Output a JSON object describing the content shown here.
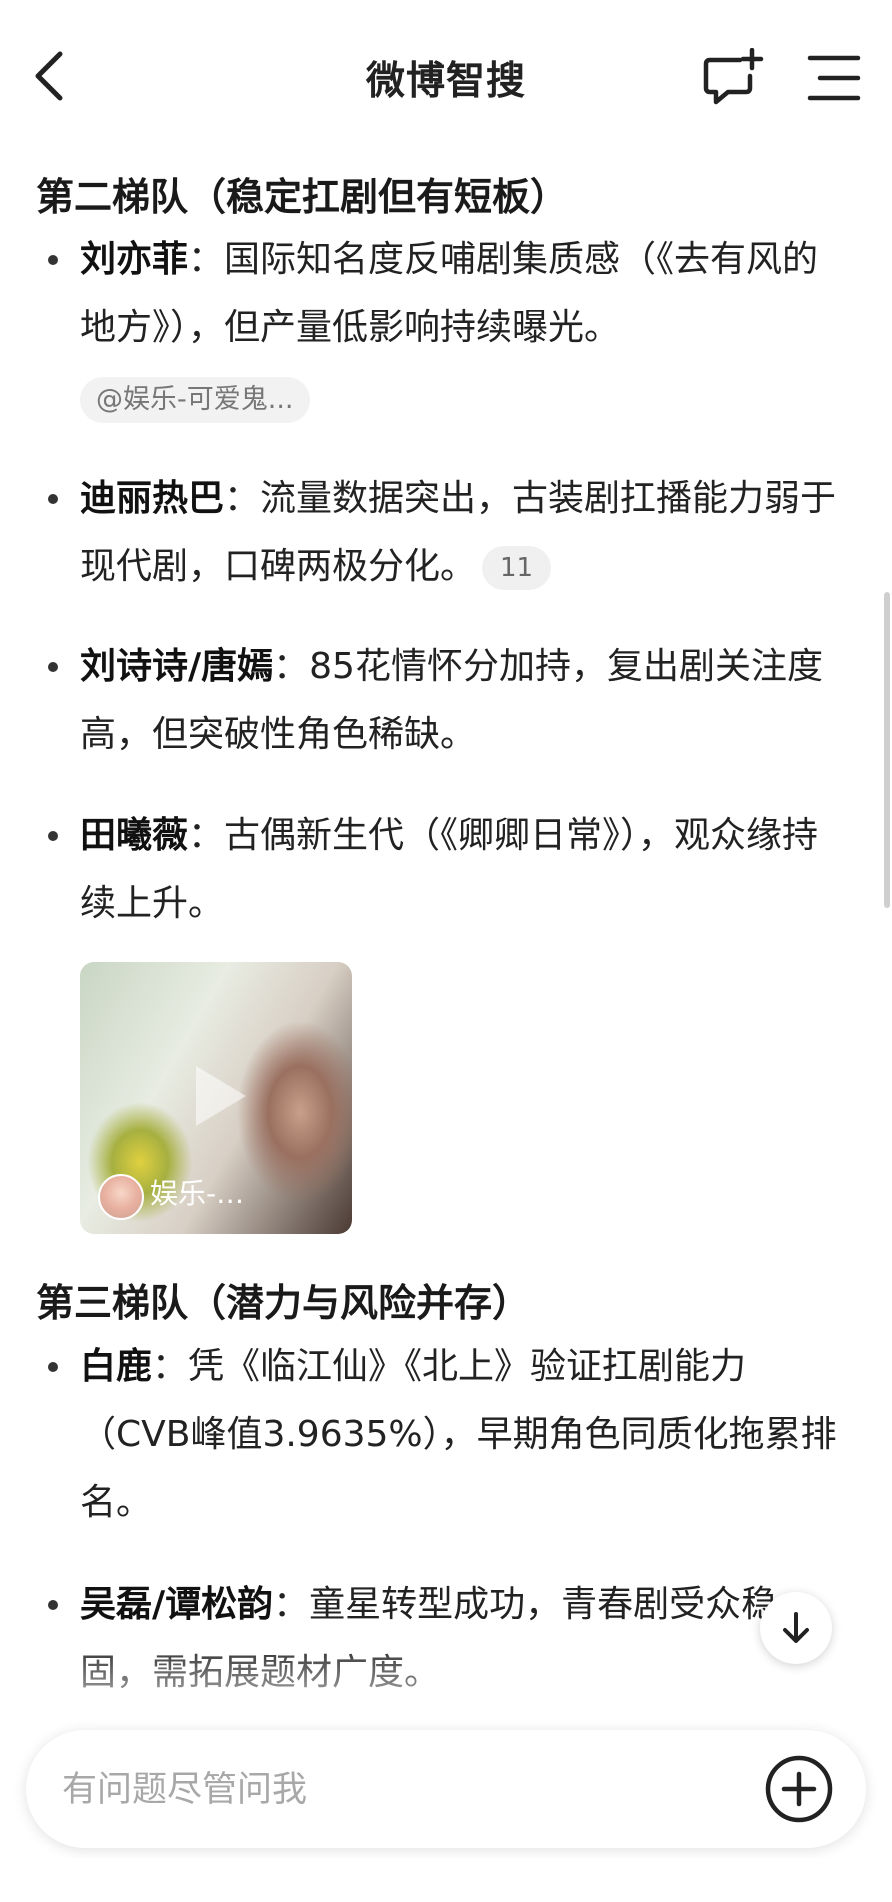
{
  "header": {
    "title": "微博智搜"
  },
  "sections": [
    {
      "title": "第二梯队（稳定扛剧但有短板）",
      "items": [
        {
          "name": "刘亦菲",
          "text": "：国际知名度反哺剧集质感（《去有风的地方》），但产量低影响持续曝光。",
          "source_tag": "@娱乐-可爱鬼..."
        },
        {
          "name": "迪丽热巴",
          "text": "：流量数据突出，古装剧扛播能力弱于现代剧，口碑两极分化。",
          "ref_count": "11"
        },
        {
          "name": "刘诗诗/唐嫣",
          "text": "：85花情怀分加持，复出剧关注度高，但突破性角色稀缺。"
        },
        {
          "name": "田曦薇",
          "text": "：古偶新生代（《卿卿日常》），观众缘持续上升。"
        }
      ],
      "video": {
        "author": "娱乐-…"
      }
    },
    {
      "title": "第三梯队（潜力与风险并存）",
      "items": [
        {
          "name": "白鹿",
          "text": "：凭《临江仙》《北上》验证扛剧能力（CVB峰值3.9635%），早期角色同质化拖累排名。"
        },
        {
          "name": "吴磊/谭松韵",
          "text": "：童星转型成功，青春剧受众稳固，需拓展题材广度。"
        }
      ]
    }
  ],
  "input": {
    "placeholder": "有问题尽管问我"
  },
  "icons": {
    "back": "back-icon",
    "new_chat": "new-chat-icon",
    "menu": "menu-icon",
    "play": "play-icon",
    "scroll_down": "arrow-down-icon",
    "add": "plus-circle-icon"
  }
}
